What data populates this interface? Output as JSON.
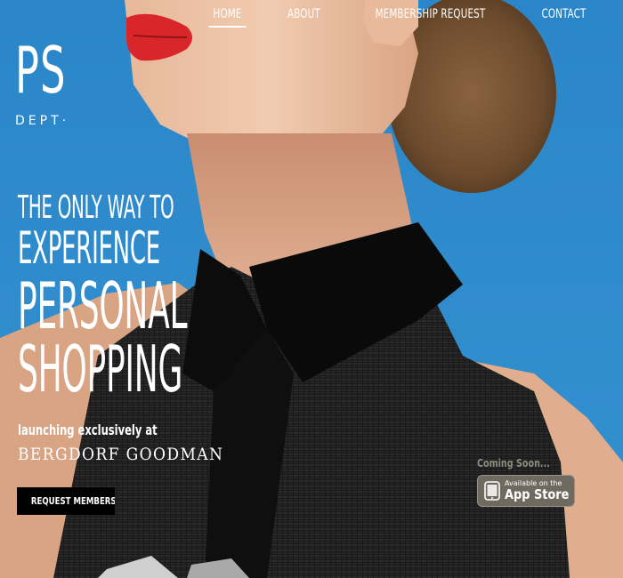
{
  "nav": {
    "items": [
      {
        "label": "HOME",
        "active": true
      },
      {
        "label": "ABOUT",
        "active": false
      },
      {
        "label": "MEMBERSHIP REQUEST",
        "active": false
      },
      {
        "label": "CONTACT",
        "active": false
      }
    ]
  },
  "logo": {
    "mark": "PS",
    "sub": "DEPT·"
  },
  "hero": {
    "headline": {
      "line1": "THE ONLY WAY TO",
      "line2": "EXPERIENCE",
      "line3": "PERSONAL",
      "line4": "SHOPPING"
    },
    "subline": "launching exclusively at",
    "store": "BERGDORF GOODMAN",
    "cta_label": "REQUEST MEMBERSHIP"
  },
  "app": {
    "coming_soon": "Coming Soon...",
    "badge_small": "Available on the",
    "badge_big": "App Store",
    "icon": "apple-icon"
  },
  "colors": {
    "sky": "#2f8ccc",
    "cta_bg": "#000000",
    "text": "#ffffff",
    "lips": "#d8262a"
  }
}
